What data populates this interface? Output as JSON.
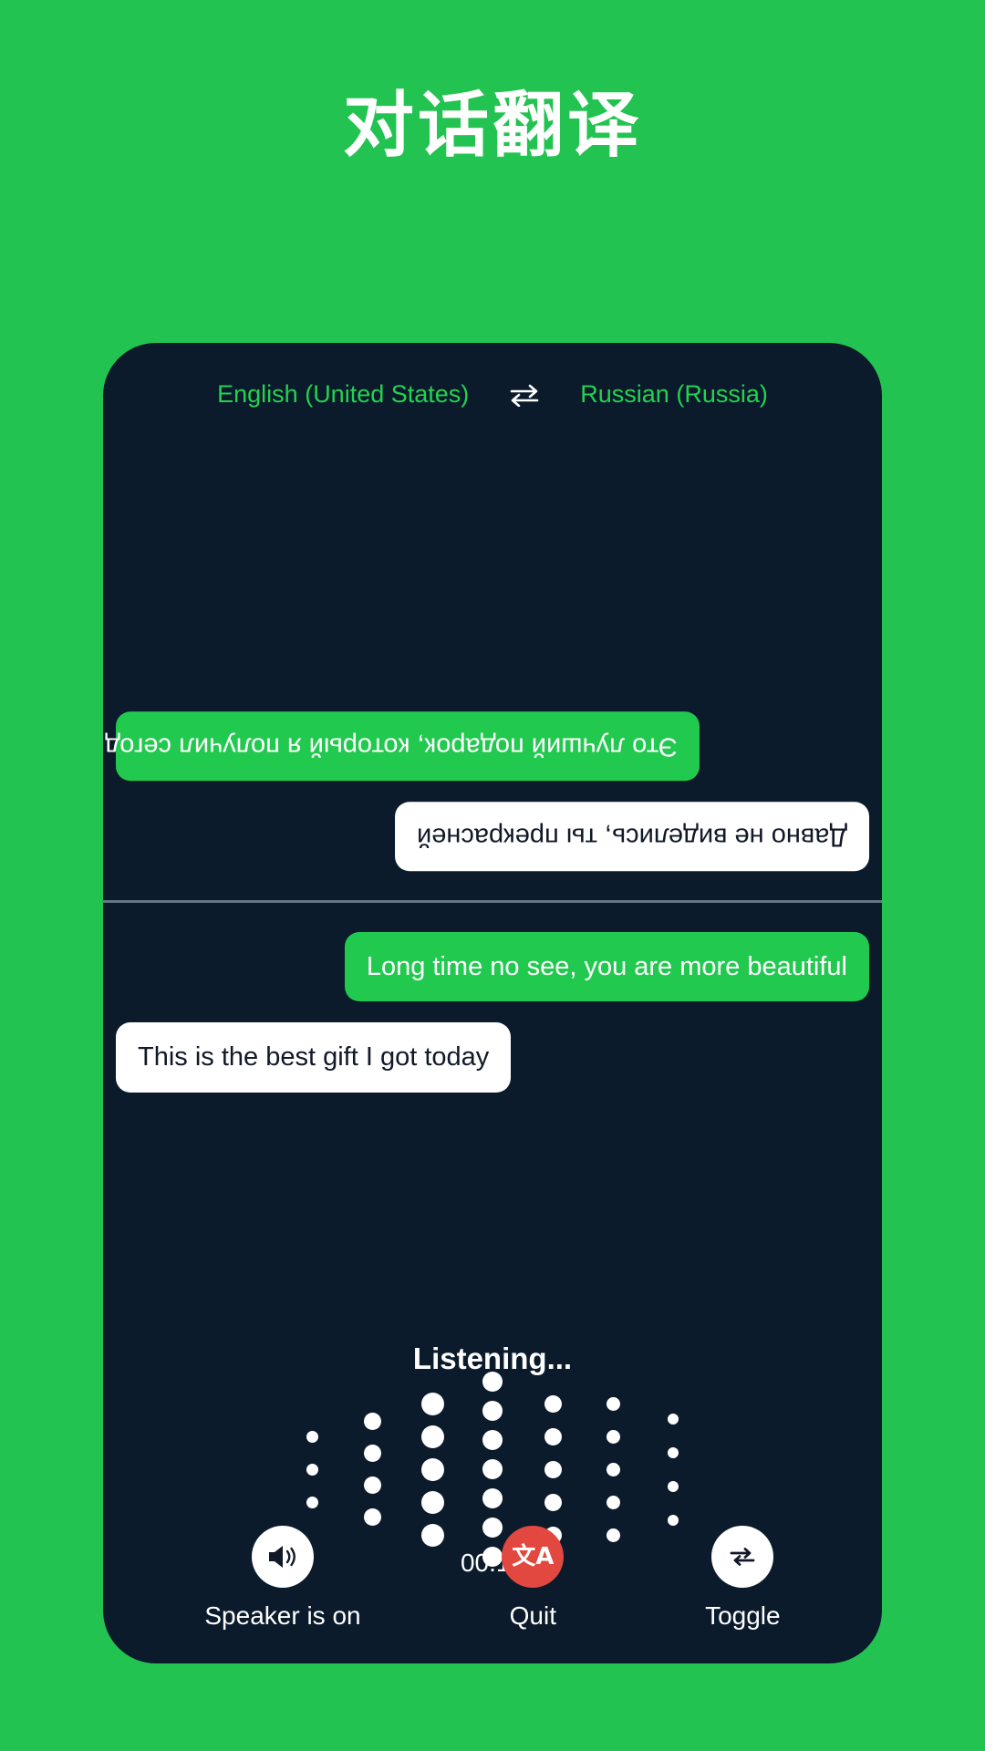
{
  "page": {
    "title": "对话翻译",
    "background_color": "#22c350",
    "card_background_color": "#0b1b2c",
    "accent_green": "#22c94f",
    "accent_red": "#e2483f"
  },
  "language_bar": {
    "source_language": "English (United States)",
    "target_language": "Russian (Russia)",
    "swap_icon": "swap-horizontal-icon"
  },
  "conversation": {
    "top_panel": [
      {
        "speaker": "target",
        "align": "left",
        "style": "green",
        "rotated": true,
        "text": "Это лучший подарок, который я получил сегодня"
      },
      {
        "speaker": "source",
        "align": "right",
        "style": "white",
        "rotated": true,
        "text": "Давно не виделись, ты прекрасней"
      }
    ],
    "bottom_panel": [
      {
        "speaker": "source",
        "align": "right",
        "style": "green",
        "rotated": false,
        "text": "Long time no see, you are more beautiful"
      },
      {
        "speaker": "target",
        "align": "left",
        "style": "white",
        "rotated": false,
        "text": "This is the best gift I got today"
      }
    ]
  },
  "status": {
    "listening_label": "Listening...",
    "timer": "00:17"
  },
  "waveform": {
    "dot_color": "#ffffff",
    "columns": [
      {
        "count": 3,
        "size": 13,
        "gap": 23
      },
      {
        "count": 4,
        "size": 19,
        "gap": 16
      },
      {
        "count": 5,
        "size": 25,
        "gap": 11
      },
      {
        "count": 7,
        "size": 22,
        "gap": 10
      },
      {
        "count": 5,
        "size": 19,
        "gap": 17
      },
      {
        "count": 5,
        "size": 15,
        "gap": 21
      },
      {
        "count": 4,
        "size": 12,
        "gap": 25
      }
    ]
  },
  "controls": [
    {
      "label": "Speaker is on",
      "icon": "speaker-on-icon",
      "circle": "white"
    },
    {
      "label": "Quit",
      "icon": "translate-icon",
      "circle": "red"
    },
    {
      "label": "Toggle",
      "icon": "toggle-swap-icon",
      "circle": "white"
    }
  ]
}
